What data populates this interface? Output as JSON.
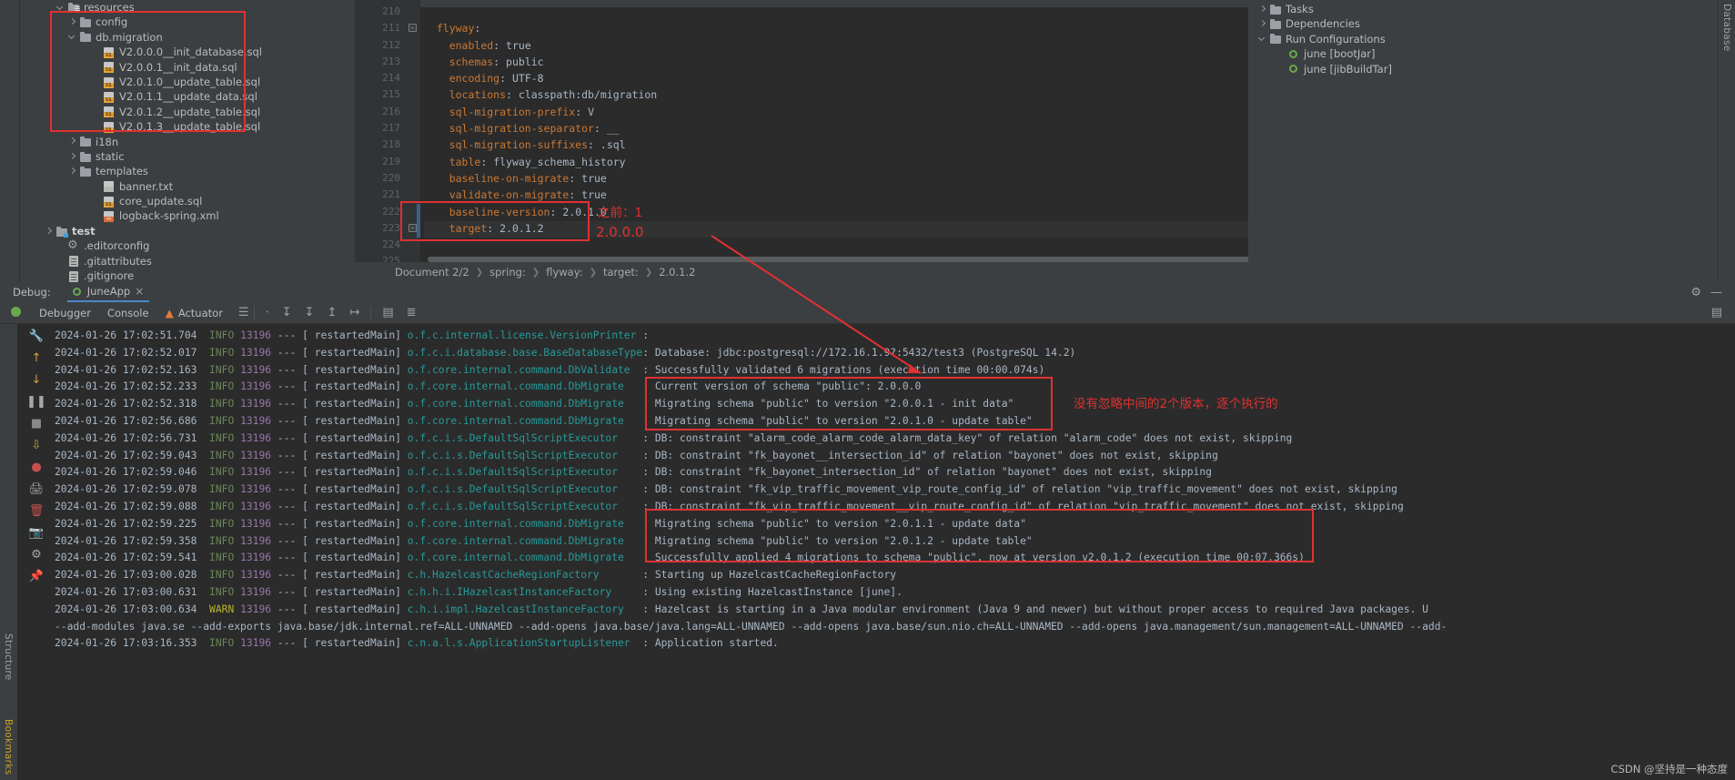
{
  "project_tree": {
    "items": [
      {
        "indent": 3,
        "toggle": "down",
        "icon": "resources-folder-icon",
        "label": "resources",
        "bold": false
      },
      {
        "indent": 4,
        "toggle": "right",
        "icon": "folder-icon",
        "label": "config",
        "bold": false
      },
      {
        "indent": 4,
        "toggle": "down",
        "icon": "folder-icon",
        "label": "db.migration",
        "bold": false
      },
      {
        "indent": 6,
        "toggle": "none",
        "icon": "sql-file-icon",
        "label": "V2.0.0.0__init_database.sql",
        "bold": false
      },
      {
        "indent": 6,
        "toggle": "none",
        "icon": "sql-file-icon",
        "label": "V2.0.0.1__init_data.sql",
        "bold": false
      },
      {
        "indent": 6,
        "toggle": "none",
        "icon": "sql-file-icon",
        "label": "V2.0.1.0__update_table.sql",
        "bold": false
      },
      {
        "indent": 6,
        "toggle": "none",
        "icon": "sql-file-icon",
        "label": "V2.0.1.1__update_data.sql",
        "bold": false
      },
      {
        "indent": 6,
        "toggle": "none",
        "icon": "sql-file-icon",
        "label": "V2.0.1.2__update_table.sql",
        "bold": false
      },
      {
        "indent": 6,
        "toggle": "none",
        "icon": "sql-file-icon",
        "label": "V2.0.1.3__update_table.sql",
        "bold": false
      },
      {
        "indent": 4,
        "toggle": "right",
        "icon": "folder-icon",
        "label": "i18n",
        "bold": false
      },
      {
        "indent": 4,
        "toggle": "right",
        "icon": "folder-icon",
        "label": "static",
        "bold": false
      },
      {
        "indent": 4,
        "toggle": "right",
        "icon": "folder-icon",
        "label": "templates",
        "bold": false
      },
      {
        "indent": 6,
        "toggle": "none",
        "icon": "txt-file-icon",
        "label": "banner.txt",
        "bold": false
      },
      {
        "indent": 6,
        "toggle": "none",
        "icon": "sql-file-icon",
        "label": "core_update.sql",
        "bold": false
      },
      {
        "indent": 6,
        "toggle": "none",
        "icon": "xml-file-icon",
        "label": "logback-spring.xml",
        "bold": false
      },
      {
        "indent": 2,
        "toggle": "right",
        "icon": "test-folder-icon",
        "label": "test",
        "bold": true
      },
      {
        "indent": 3,
        "toggle": "none",
        "icon": "gear-icon",
        "label": ".editorconfig",
        "bold": false
      },
      {
        "indent": 3,
        "toggle": "none",
        "icon": "file-icon",
        "label": ".gitattributes",
        "bold": false
      },
      {
        "indent": 3,
        "toggle": "none",
        "icon": "file-icon",
        "label": ".gitignore",
        "bold": false
      }
    ]
  },
  "editor": {
    "lines": [
      {
        "num": "210",
        "indent": 0,
        "key": "",
        "sep": "",
        "val": ""
      },
      {
        "num": "211",
        "indent": 2,
        "key": "flyway",
        "sep": ":",
        "val": "",
        "fold": true
      },
      {
        "num": "212",
        "indent": 4,
        "key": "enabled",
        "sep": ":",
        "val": "true"
      },
      {
        "num": "213",
        "indent": 4,
        "key": "schemas",
        "sep": ":",
        "val": "public"
      },
      {
        "num": "214",
        "indent": 4,
        "key": "encoding",
        "sep": ":",
        "val": "UTF-8"
      },
      {
        "num": "215",
        "indent": 4,
        "key": "locations",
        "sep": ":",
        "val": "classpath:db/migration"
      },
      {
        "num": "216",
        "indent": 4,
        "key": "sql-migration-prefix",
        "sep": ":",
        "val": "V"
      },
      {
        "num": "217",
        "indent": 4,
        "key": "sql-migration-separator",
        "sep": ":",
        "val": "__"
      },
      {
        "num": "218",
        "indent": 4,
        "key": "sql-migration-suffixes",
        "sep": ":",
        "val": ".sql"
      },
      {
        "num": "219",
        "indent": 4,
        "key": "table",
        "sep": ":",
        "val": "flyway_schema_history"
      },
      {
        "num": "220",
        "indent": 4,
        "key": "baseline-on-migrate",
        "sep": ":",
        "val": "true"
      },
      {
        "num": "221",
        "indent": 4,
        "key": "validate-on-migrate",
        "sep": ":",
        "val": "true"
      },
      {
        "num": "222",
        "indent": 4,
        "key": "baseline-version",
        "sep": ":",
        "val": "2.0.1.0"
      },
      {
        "num": "223",
        "indent": 4,
        "key": "target",
        "sep": ":",
        "val": "2.0.1.2"
      },
      {
        "num": "224",
        "indent": 0,
        "key": "",
        "sep": "",
        "val": ""
      },
      {
        "num": "225",
        "indent": 0,
        "key": "",
        "sep": "",
        "val": ""
      }
    ],
    "breadcrumb": [
      "Document 2/2",
      "spring:",
      "flyway:",
      "target:",
      "2.0.1.2"
    ]
  },
  "right_panel": {
    "items": [
      {
        "indent": 1,
        "toggle": "right",
        "icon": "tasks-icon",
        "label": "Tasks"
      },
      {
        "indent": 1,
        "toggle": "right",
        "icon": "dependencies-icon",
        "label": "Dependencies"
      },
      {
        "indent": 1,
        "toggle": "down",
        "icon": "run-config-icon",
        "label": "Run Configurations"
      },
      {
        "indent": 3,
        "toggle": "none",
        "icon": "spring-run-icon",
        "label": "june [bootJar]"
      },
      {
        "indent": 3,
        "toggle": "none",
        "icon": "spring-run-icon",
        "label": "june [jibBuildTar]"
      }
    ],
    "vertical_tab": "Database"
  },
  "left_vertical_tabs": [
    "Structure",
    "Bookmarks"
  ],
  "debug_panel": {
    "title": "Debug:",
    "tab_label": "JuneApp",
    "close_label": "×",
    "settings_icon": "gear-icon",
    "minimize_icon": "minimize-icon",
    "subtabs": [
      {
        "label": "Debugger",
        "icon": ""
      },
      {
        "label": "Console",
        "icon": ""
      },
      {
        "label": "Actuator",
        "icon": "actuator-icon"
      }
    ]
  },
  "annotations": {
    "editor_note_line1": "之前：1",
    "editor_note_line2": "2.0.0.0",
    "console_note": "没有忽略中间的2个版本，逐个执行的",
    "highlight_color": "#e03131"
  },
  "watermark": "CSDN @坚持是一种态度",
  "console_log": {
    "rows": [
      {
        "time": "2024-01-26 17:02:51.704",
        "level": "INFO",
        "pid": "13196",
        "thread": "restartedMain",
        "logger": "o.f.c.internal.license.VersionPrinter",
        "msg": ""
      },
      {
        "time": "2024-01-26 17:02:52.017",
        "level": "INFO",
        "pid": "13196",
        "thread": "restartedMain",
        "logger": "o.f.c.i.database.base.BaseDatabaseType",
        "msg": "Database: jdbc:postgresql://172.16.1.9?:5432/test3 (PostgreSQL 14.2)"
      },
      {
        "time": "2024-01-26 17:02:52.163",
        "level": "INFO",
        "pid": "13196",
        "thread": "restartedMain",
        "logger": "o.f.core.internal.command.DbValidate",
        "msg": "Successfully validated 6 migrations (execution time 00:00.074s)"
      },
      {
        "time": "2024-01-26 17:02:52.233",
        "level": "INFO",
        "pid": "13196",
        "thread": "restartedMain",
        "logger": "o.f.core.internal.command.DbMigrate",
        "msg": "Current version of schema \"public\": 2.0.0.0"
      },
      {
        "time": "2024-01-26 17:02:52.318",
        "level": "INFO",
        "pid": "13196",
        "thread": "restartedMain",
        "logger": "o.f.core.internal.command.DbMigrate",
        "msg": "Migrating schema \"public\" to version \"2.0.0.1 - init data\""
      },
      {
        "time": "2024-01-26 17:02:56.686",
        "level": "INFO",
        "pid": "13196",
        "thread": "restartedMain",
        "logger": "o.f.core.internal.command.DbMigrate",
        "msg": "Migrating schema \"public\" to version \"2.0.1.0 - update table\""
      },
      {
        "time": "2024-01-26 17:02:56.731",
        "level": "INFO",
        "pid": "13196",
        "thread": "restartedMain",
        "logger": "o.f.c.i.s.DefaultSqlScriptExecutor",
        "msg": "DB: constraint \"alarm_code_alarm_code_alarm_data_key\" of relation \"alarm_code\" does not exist, skipping"
      },
      {
        "time": "2024-01-26 17:02:59.043",
        "level": "INFO",
        "pid": "13196",
        "thread": "restartedMain",
        "logger": "o.f.c.i.s.DefaultSqlScriptExecutor",
        "msg": "DB: constraint \"fk_bayonet__intersection_id\" of relation \"bayonet\" does not exist, skipping"
      },
      {
        "time": "2024-01-26 17:02:59.046",
        "level": "INFO",
        "pid": "13196",
        "thread": "restartedMain",
        "logger": "o.f.c.i.s.DefaultSqlScriptExecutor",
        "msg": "DB: constraint \"fk_bayonet_intersection_id\" of relation \"bayonet\" does not exist, skipping"
      },
      {
        "time": "2024-01-26 17:02:59.078",
        "level": "INFO",
        "pid": "13196",
        "thread": "restartedMain",
        "logger": "o.f.c.i.s.DefaultSqlScriptExecutor",
        "msg": "DB: constraint \"fk_vip_traffic_movement_vip_route_config_id\" of relation \"vip_traffic_movement\" does not exist, skipping"
      },
      {
        "time": "2024-01-26 17:02:59.088",
        "level": "INFO",
        "pid": "13196",
        "thread": "restartedMain",
        "logger": "o.f.c.i.s.DefaultSqlScriptExecutor",
        "msg": "DB: constraint \"fk_vip_traffic_movement__vip_route_config_id\" of relation \"vip_traffic_movement\" does not exist, skipping"
      },
      {
        "time": "2024-01-26 17:02:59.225",
        "level": "INFO",
        "pid": "13196",
        "thread": "restartedMain",
        "logger": "o.f.core.internal.command.DbMigrate",
        "msg": "Migrating schema \"public\" to version \"2.0.1.1 - update data\""
      },
      {
        "time": "2024-01-26 17:02:59.358",
        "level": "INFO",
        "pid": "13196",
        "thread": "restartedMain",
        "logger": "o.f.core.internal.command.DbMigrate",
        "msg": "Migrating schema \"public\" to version \"2.0.1.2 - update table\""
      },
      {
        "time": "2024-01-26 17:02:59.541",
        "level": "INFO",
        "pid": "13196",
        "thread": "restartedMain",
        "logger": "o.f.core.internal.command.DbMigrate",
        "msg": "Successfully applied 4 migrations to schema \"public\", now at version v2.0.1.2 (execution time 00:07.366s)"
      },
      {
        "time": "2024-01-26 17:03:00.028",
        "level": "INFO",
        "pid": "13196",
        "thread": "restartedMain",
        "logger": "c.h.HazelcastCacheRegionFactory",
        "msg": "Starting up HazelcastCacheRegionFactory"
      },
      {
        "time": "2024-01-26 17:03:00.631",
        "level": "INFO",
        "pid": "13196",
        "thread": "restartedMain",
        "logger": "c.h.h.i.IHazelcastInstanceFactory",
        "msg": "Using existing HazelcastInstance [june]."
      },
      {
        "time": "2024-01-26 17:03:00.634",
        "level": "WARN",
        "pid": "13196",
        "thread": "restartedMain",
        "logger": "c.h.i.impl.HazelcastInstanceFactory",
        "msg": "Hazelcast is starting in a Java modular environment (Java 9 and newer) but without proper access to required Java packages. U"
      },
      {
        "continuation": "--add-modules java.se --add-exports java.base/jdk.internal.ref=ALL-UNNAMED --add-opens java.base/java.lang=ALL-UNNAMED --add-opens java.base/sun.nio.ch=ALL-UNNAMED --add-opens java.management/sun.management=ALL-UNNAMED --add-"
      },
      {
        "time": "2024-01-26 17:03:16.353",
        "level": "INFO",
        "pid": "13196",
        "thread": "restartedMain",
        "logger": "c.n.a.l.s.ApplicationStartupListener",
        "msg": "Application started."
      }
    ]
  }
}
